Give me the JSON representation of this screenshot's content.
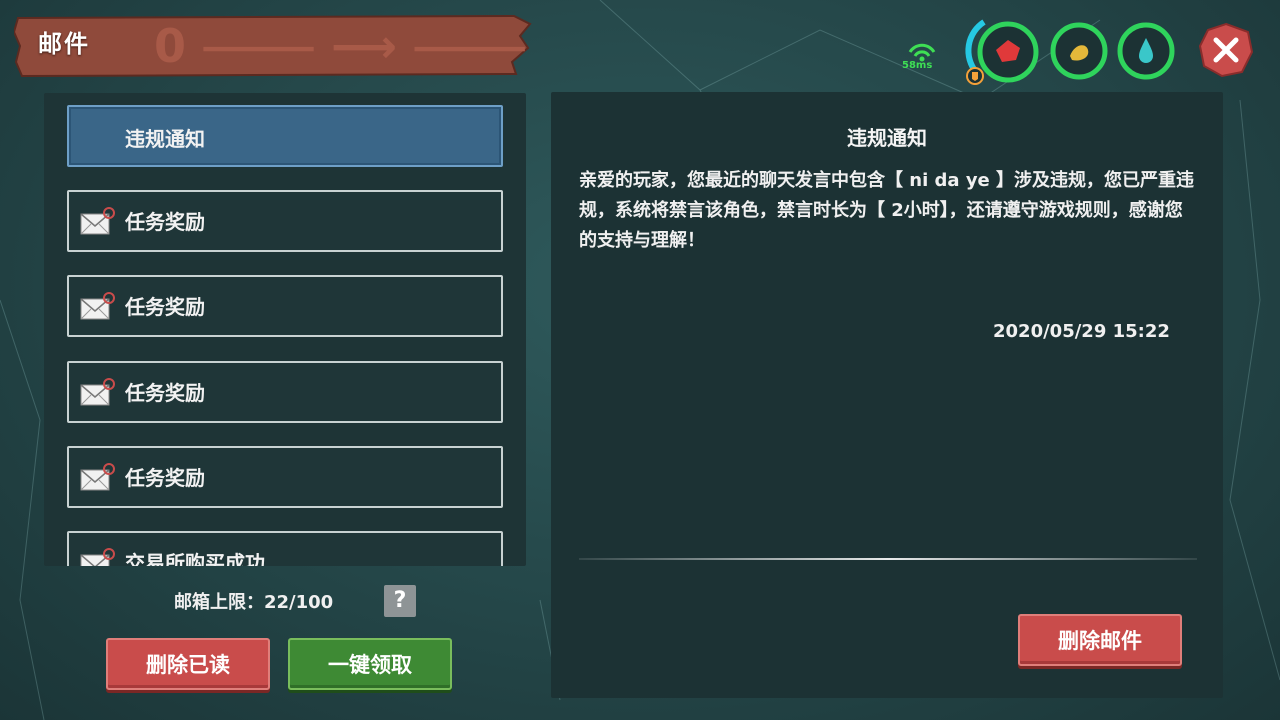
{
  "header": {
    "title": "邮件"
  },
  "mail_list": {
    "items": [
      {
        "label": "违规通知",
        "selected": true,
        "icon": "none"
      },
      {
        "label": "任务奖励",
        "selected": false,
        "icon": "envelope-icon"
      },
      {
        "label": "任务奖励",
        "selected": false,
        "icon": "envelope-icon"
      },
      {
        "label": "任务奖励",
        "selected": false,
        "icon": "envelope-icon"
      },
      {
        "label": "任务奖励",
        "selected": false,
        "icon": "envelope-icon"
      },
      {
        "label": "交易所购买成功",
        "selected": false,
        "icon": "envelope-icon"
      }
    ]
  },
  "footer": {
    "capacity_label": "邮箱上限：22/100",
    "help_label": "?",
    "delete_read_label": "删除已读",
    "claim_all_label": "一键领取"
  },
  "detail": {
    "title": "违规通知",
    "body": "亲爱的玩家，您最近的聊天发言中包含【  ni da ye  】涉及违规，您已严重违规，系统将禁言该角色，禁言时长为【 2小时】，还请遵守游戏规则，感谢您的支持与理解！",
    "date": "2020/05/29 15:22",
    "delete_label": "删除邮件"
  },
  "hud": {
    "ping": "58ms",
    "stats": [
      {
        "name": "health",
        "icon": "heart-icon",
        "color": "#e0393a"
      },
      {
        "name": "hunger",
        "icon": "stomach-icon",
        "color": "#e4b83a"
      },
      {
        "name": "thirst",
        "icon": "water-drop-icon",
        "color": "#3ac7c9"
      }
    ],
    "colors": {
      "ring": "#2fd45c",
      "accent_cyan": "#26c9e3"
    }
  }
}
